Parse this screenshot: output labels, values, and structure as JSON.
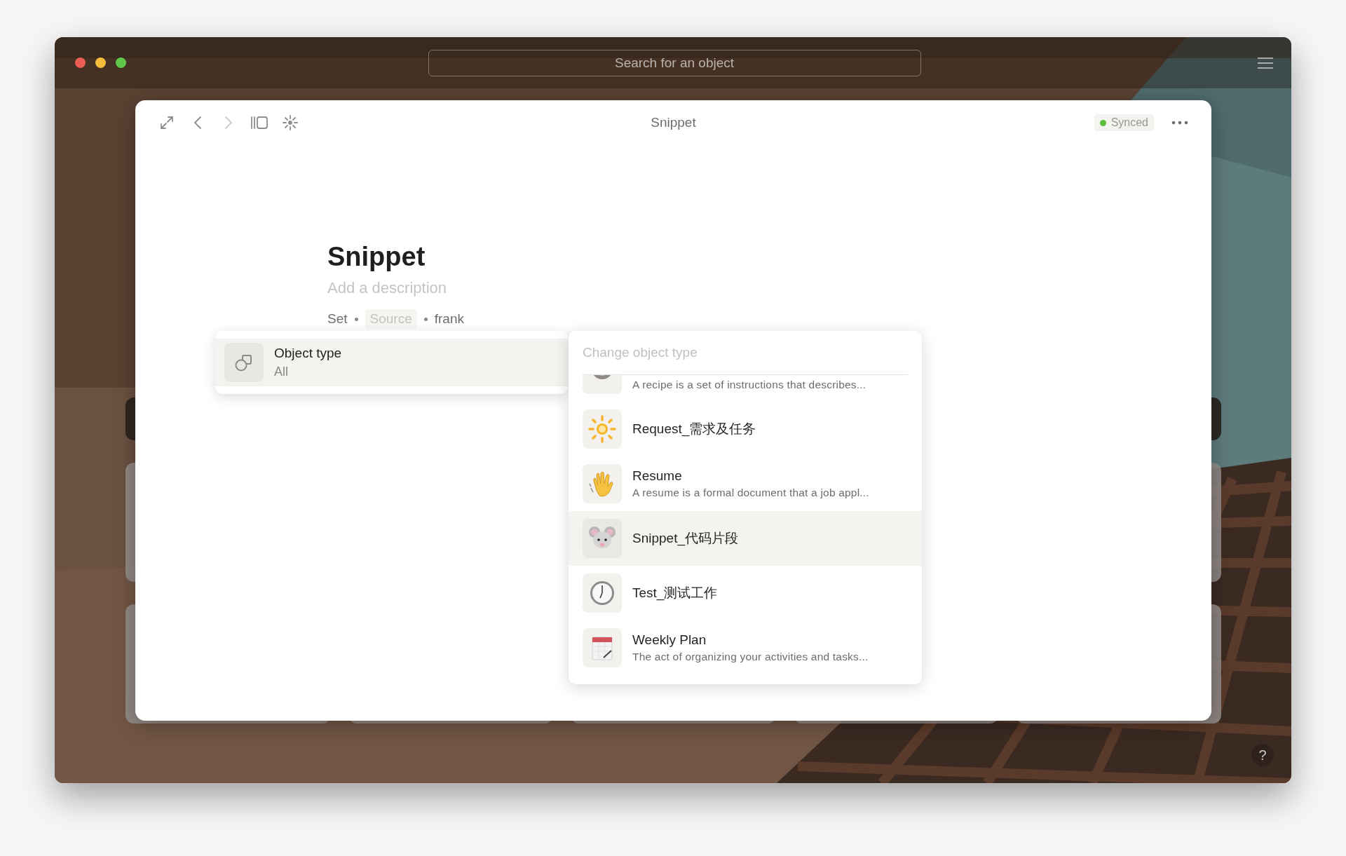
{
  "window": {
    "search": {
      "placeholder": "Search for an object"
    }
  },
  "modal": {
    "title": "Snippet",
    "status": "Synced",
    "toolbar": {
      "back": {
        "disabled": false
      },
      "forward": {
        "disabled": true
      }
    }
  },
  "object": {
    "title": "Snippet",
    "description": {
      "placeholder": "Add a description"
    },
    "meta": [
      {
        "text": "Set",
        "kind": "value"
      },
      {
        "text": "Source",
        "kind": "empty"
      },
      {
        "text": "frank",
        "kind": "value"
      }
    ]
  },
  "relation_menu": {
    "items": [
      {
        "label": "Object type",
        "value": "All",
        "selected": true
      }
    ]
  },
  "type_picker": {
    "placeholder": "Change object type",
    "items": [
      {
        "description": "A recipe is a set of instructions that describes...",
        "selected": false
      },
      {
        "name": "Request_需求及任务",
        "selected": false
      },
      {
        "name": "Resume",
        "description": "A resume is a formal document that a job appl...",
        "selected": false
      },
      {
        "name": "Snippet_代码片段",
        "selected": true
      },
      {
        "name": "Test_测试工作",
        "selected": false
      },
      {
        "name": "Weekly Plan",
        "description": "The act of organizing your activities and tasks...",
        "selected": false
      }
    ]
  },
  "help_button": {
    "label": "?"
  }
}
